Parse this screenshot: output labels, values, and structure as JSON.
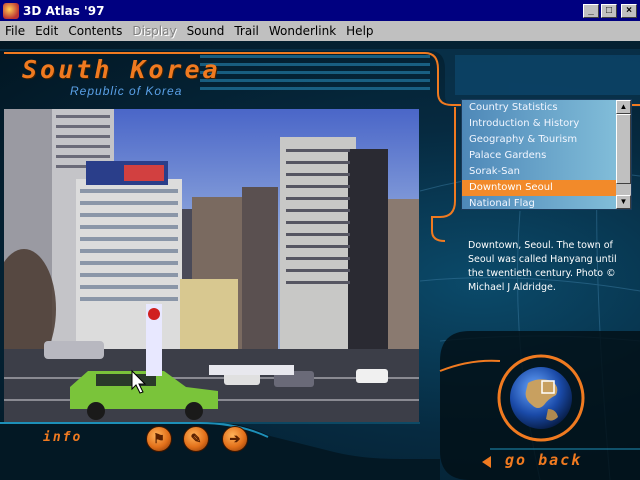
{
  "window": {
    "title": "3D Atlas '97",
    "minimize_icon": "minimize-icon",
    "maximize_icon": "maximize-icon",
    "close_icon": "close-icon"
  },
  "menu": [
    {
      "label": "File",
      "enabled": true
    },
    {
      "label": "Edit",
      "enabled": true
    },
    {
      "label": "Contents",
      "enabled": true
    },
    {
      "label": "Display",
      "enabled": false
    },
    {
      "label": "Sound",
      "enabled": true
    },
    {
      "label": "Trail",
      "enabled": true
    },
    {
      "label": "Wonderlink",
      "enabled": true
    },
    {
      "label": "Help",
      "enabled": true
    }
  ],
  "country": {
    "name": "South Korea",
    "official_name": "Republic of Korea"
  },
  "topics": {
    "items": [
      "Country Statistics",
      "Introduction & History",
      "Geography & Tourism",
      "Palace Gardens",
      "Sorak-San",
      "Downtown Seoul",
      "National Flag"
    ],
    "selected_index": 5
  },
  "caption": "Downtown, Seoul. The town of Seoul was called Hanyang until the twentieth century. Photo © Michael J Aldridge.",
  "controls": {
    "info_label": "info",
    "back_label": "go back",
    "buttons": [
      "flag-icon",
      "notepad-icon",
      "arrow-right-icon"
    ]
  },
  "colors": {
    "accent_orange": "#f07a20",
    "selected_topic": "#f28a2a",
    "subtitle_blue": "#5aa0e6",
    "titlebar": "#000080"
  }
}
